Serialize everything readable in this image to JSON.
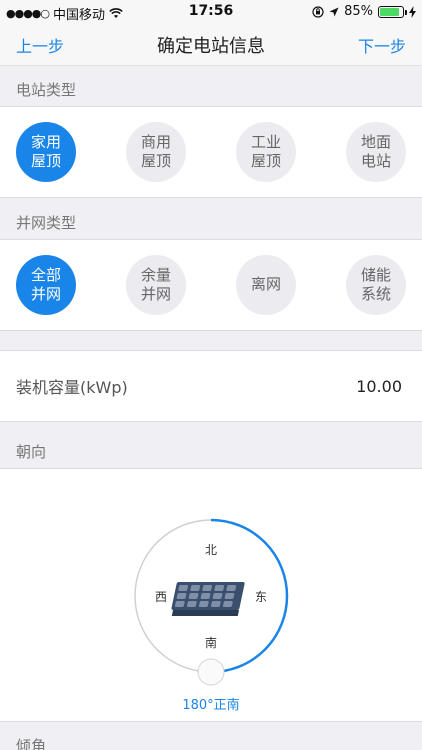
{
  "status_bar": {
    "carrier": "中国移动",
    "time": "17:56",
    "battery_percent": "85%",
    "battery_level": 0.85,
    "signal_icon": "signal-dots-icon",
    "wifi_icon": "wifi-icon",
    "lock_icon": "rotation-lock-icon",
    "location_icon": "location-arrow-icon",
    "charging_icon": "charging-bolt-icon"
  },
  "nav": {
    "back_label": "上一步",
    "title": "确定电站信息",
    "next_label": "下一步"
  },
  "station_type": {
    "header": "电站类型",
    "options": [
      {
        "line1": "家用",
        "line2": "屋顶",
        "selected": true
      },
      {
        "line1": "商用",
        "line2": "屋顶",
        "selected": false
      },
      {
        "line1": "工业",
        "line2": "屋顶",
        "selected": false
      },
      {
        "line1": "地面",
        "line2": "电站",
        "selected": false
      }
    ]
  },
  "grid_type": {
    "header": "并网类型",
    "options": [
      {
        "line1": "全部",
        "line2": "并网",
        "selected": true
      },
      {
        "line1": "余量",
        "line2": "并网",
        "selected": false
      },
      {
        "line1": "离网",
        "line2": "",
        "selected": false
      },
      {
        "line1": "储能",
        "line2": "系统",
        "selected": false
      }
    ]
  },
  "capacity": {
    "label": "装机容量(kWp)",
    "value": "10.00"
  },
  "orientation": {
    "header": "朝向",
    "north": "北",
    "south": "南",
    "east": "东",
    "west": "西",
    "angle_label": "180°正南",
    "angle_degrees": 180
  },
  "tilt": {
    "header": "倾角"
  },
  "colors": {
    "accent": "#1a85e8",
    "selected_text": "#ffffff",
    "unselected_bg": "#ebebf0"
  }
}
